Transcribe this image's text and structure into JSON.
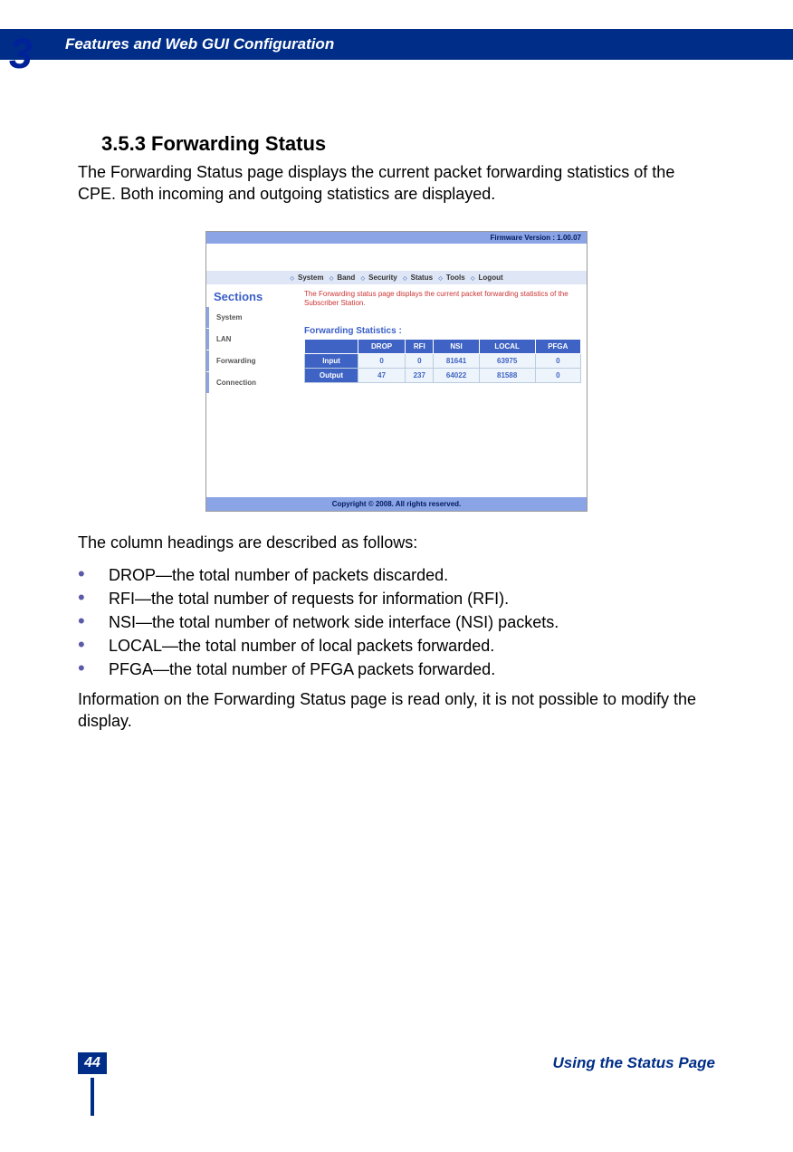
{
  "chapter_number": "3",
  "header_title": "Features and Web GUI Configuration",
  "section_heading": "3.5.3 Forwarding Status",
  "intro_para": "The Forwarding Status page displays the current packet forwarding statistics of the CPE. Both incoming and outgoing statistics are displayed.",
  "screenshot": {
    "firmware_label": "Firmware Version : 1.00.07",
    "menu_items": [
      "System",
      "Band",
      "Security",
      "Status",
      "Tools",
      "Logout"
    ],
    "sidebar_title": "Sections",
    "sidebar_items": [
      "System",
      "LAN",
      "Forwarding",
      "Connection"
    ],
    "description": "The Forwarding status page displays the current packet forwarding statistics of the Subscriber Station.",
    "table_title": "Forwarding Statistics :",
    "columns": [
      "",
      "DROP",
      "RFI",
      "NSI",
      "LOCAL",
      "PFGA"
    ],
    "rows": [
      {
        "label": "Input",
        "values": [
          "0",
          "0",
          "81641",
          "63975",
          "0"
        ]
      },
      {
        "label": "Output",
        "values": [
          "47",
          "237",
          "64022",
          "81588",
          "0"
        ]
      }
    ],
    "footer": "Copyright © 2008.  All rights reserved."
  },
  "columns_intro": "The column headings are described as follows:",
  "bullets": [
    "DROP—the total number of packets discarded.",
    "RFI—the total number of requests for information (RFI).",
    "NSI—the total number of network side interface (NSI) packets.",
    "LOCAL—the total number of local packets forwarded.",
    "PFGA—the total number of PFGA packets forwarded."
  ],
  "closing_para": "Information on the Forwarding Status page is read only, it is not possible to modify the display.",
  "page_number": "44",
  "footer_title": "Using the Status Page"
}
